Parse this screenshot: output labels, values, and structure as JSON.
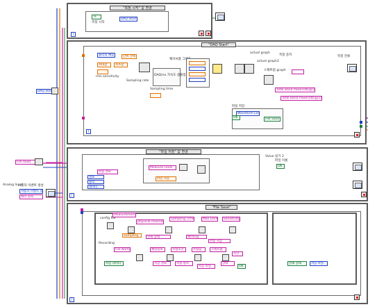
{
  "frame1": {
    "case_selector": "\"측정 시작\" 값 변경",
    "label_measure_start": "측정 시작",
    "control_bool": "TF",
    "control_start": "DAQ Start",
    "iter_label": "i"
  },
  "frame2": {
    "case_selector": "\"DAQ Start\"",
    "label_physical_channel": "물리적 채널",
    "label_unit_volt": "단위 선택",
    "label_max": "최대값",
    "label_min": "최소값",
    "label_rms": "rms sensitivity",
    "label_sampling_rate": "Sampling rate",
    "label_sampling_time": "Sampling time",
    "label_waveform_graph": "웨이브폼 그래프",
    "label_daq_mx": "DAQmx 가속도 샘플링",
    "label_actual": "actual graph",
    "label_actual2": "actual graph2",
    "label_spectrum": "스펙트럼 graph",
    "label_total_band": "Total Band Power(db)g(1)",
    "label_total_band2": "Total Band Power(db)g(2)",
    "label_measure": "측정 중지",
    "label_file_save": "파일 저장",
    "label_waveform_level": "Waveform Level",
    "label_file_save2": "File Save",
    "label_ok": "OK",
    "label_stop": "stop",
    "label_measure_current": "측정 전류",
    "label_input": "input"
  },
  "left_inputs": {
    "daq_start": "DAQ Start",
    "file_read": "File Read",
    "analog_input": "Analog Input",
    "user_event": "사용자 이벤트 생성",
    "user_event2": "사용자 이벤트 등록",
    "error_in": "에러 입력"
  },
  "frame3": {
    "case_selector": "\"파일 저장\" 값 변경",
    "label_value_clear": "Value 읽기 2",
    "label_file_path": "파일 경로",
    "label_measure_level": "Measure Level",
    "label_file_name": "파일 이름",
    "label_save": "파일 저장",
    "label_path": "경로",
    "label_type": "형식",
    "label_data": "데이터",
    "label_ok": "OK"
  },
  "frame4": {
    "case_selector": "\"File Save\"",
    "label_measurement": "Measurement",
    "label_physical_channels": "physical channels",
    "label_sampling_time": "Sampling Time",
    "label_max_level": "Max Level",
    "label_sensitivity": "Sensitivity",
    "label_config_file": "config file",
    "label_recording": "Recording",
    "label_file_name": "File Name",
    "label_channel_info": "채널정보",
    "label_measure_cond": "측정조건",
    "label_measure_value": "측정값",
    "label_spectrum": "스펙트럼",
    "label_time": "시간",
    "label_save_data": "저장 데이터",
    "label_save_path": "저장 경로",
    "label_ok": "OK",
    "label_current_status": "현재 상태",
    "label_sampling": "Sampling",
    "label_save_file": "파일 저장",
    "label_writing": "Writing",
    "label_measurement_2": "측정 항목",
    "label_data_save": "저장 파일",
    "label_status": "상태"
  },
  "colors": {
    "wire_blue": "#2040c0",
    "wire_pink": "#c020a0",
    "wire_orange": "#e07000",
    "wire_green": "#208040",
    "frame": "#5a5a5a"
  }
}
